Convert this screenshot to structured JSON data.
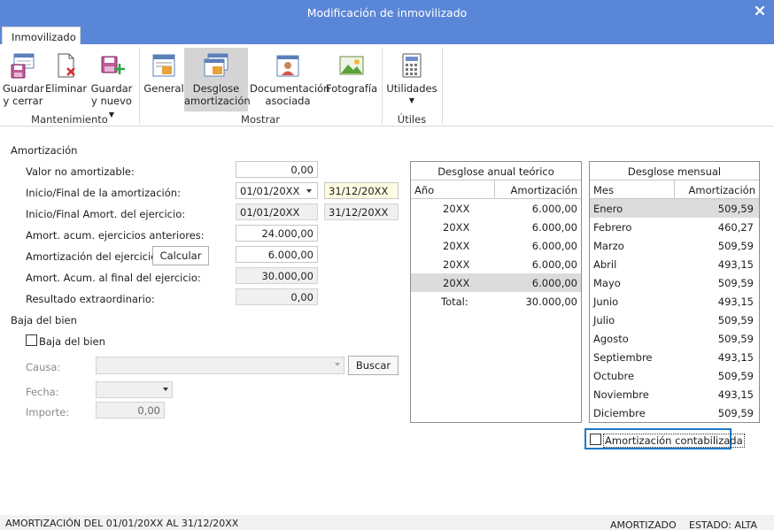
{
  "window": {
    "title": "Modificación de inmovilizado",
    "close_glyph": "✕"
  },
  "tabs": [
    {
      "label": "Inmovilizado"
    }
  ],
  "ribbon": {
    "buttons": {
      "guardar_cerrar": {
        "line1": "Guardar",
        "line2": "y cerrar",
        "icon": "save-close-icon"
      },
      "eliminar": {
        "line1": "Eliminar",
        "icon": "delete-document-icon"
      },
      "guardar_nuevo": {
        "line1": "Guardar",
        "line2": "y nuevo",
        "icon": "save-new-icon"
      },
      "general": {
        "line1": "General",
        "icon": "general-form-icon"
      },
      "desglose": {
        "line1": "Desglose",
        "line2": "amortización",
        "icon": "amortization-breakdown-icon"
      },
      "documentacion": {
        "line1": "Documentación",
        "line2": "asociada",
        "icon": "associated-documents-icon"
      },
      "fotografia": {
        "line1": "Fotografía",
        "icon": "photo-icon"
      },
      "utilidades": {
        "line1": "Utilidades",
        "icon": "calculator-icon"
      }
    },
    "groups": {
      "mantenimiento": "Mantenimiento",
      "mostrar": "Mostrar",
      "utiles": "Útiles"
    }
  },
  "form": {
    "section_amortizacion": "Amortización",
    "valor_no_amortizable": {
      "label": "Valor no amortizable:",
      "value": "0,00"
    },
    "inicio_final": {
      "label": "Inicio/Final de la amortización:",
      "start": "01/01/20XX",
      "end": "31/12/20XX"
    },
    "inicio_final_ejercicio": {
      "label": "Inicio/Final Amort. del ejercicio:",
      "start": "01/01/20XX",
      "end": "31/12/20XX"
    },
    "acum_anteriores": {
      "label": "Amort. acum. ejercicios anteriores:",
      "value": "24.000,00"
    },
    "amort_ejercicio": {
      "label": "Amortización del ejercicio:",
      "value": "6.000,00",
      "button": "Calcular"
    },
    "acum_final": {
      "label": "Amort. Acum. al final del ejercicio:",
      "value": "30.000,00"
    },
    "resultado_extra": {
      "label": "Resultado extraordinario:",
      "value": "0,00"
    },
    "section_baja": "Baja del bien",
    "baja_checkbox": "Baja del bien",
    "causa": {
      "label": "Causa:",
      "value": "",
      "button": "Buscar"
    },
    "fecha": {
      "label": "Fecha:",
      "value": ""
    },
    "importe": {
      "label": "Importe:",
      "value": "0,00"
    }
  },
  "desglose_anual": {
    "title": "Desglose anual teórico",
    "columns": [
      "Año",
      "Amortización"
    ],
    "rows": [
      [
        "20XX",
        "6.000,00"
      ],
      [
        "20XX",
        "6.000,00"
      ],
      [
        "20XX",
        "6.000,00"
      ],
      [
        "20XX",
        "6.000,00"
      ],
      [
        "20XX",
        "6.000,00"
      ]
    ],
    "total_label": "Total:",
    "total_value": "30.000,00"
  },
  "desglose_mensual": {
    "title": "Desglose mensual",
    "columns": [
      "Mes",
      "Amortización"
    ],
    "rows": [
      [
        "Enero",
        "509,59"
      ],
      [
        "Febrero",
        "460,27"
      ],
      [
        "Marzo",
        "509,59"
      ],
      [
        "Abril",
        "493,15"
      ],
      [
        "Mayo",
        "509,59"
      ],
      [
        "Junio",
        "493,15"
      ],
      [
        "Julio",
        "509,59"
      ],
      [
        "Agosto",
        "509,59"
      ],
      [
        "Septiembre",
        "493,15"
      ],
      [
        "Octubre",
        "509,59"
      ],
      [
        "Noviembre",
        "493,15"
      ],
      [
        "Diciembre",
        "509,59"
      ]
    ]
  },
  "amortizacion_contabilizada": "Amortización contabilizada",
  "statusbar": {
    "left": "AMORTIZACIÓN DEL 01/01/20XX AL 31/12/20XX",
    "amortizado": "AMORTIZADO",
    "estado": "ESTADO: ALTA"
  },
  "colors": {
    "titlebar": "#5a86d8",
    "selected_row": "#dcdcdc",
    "focus_border": "#1e78c8"
  }
}
